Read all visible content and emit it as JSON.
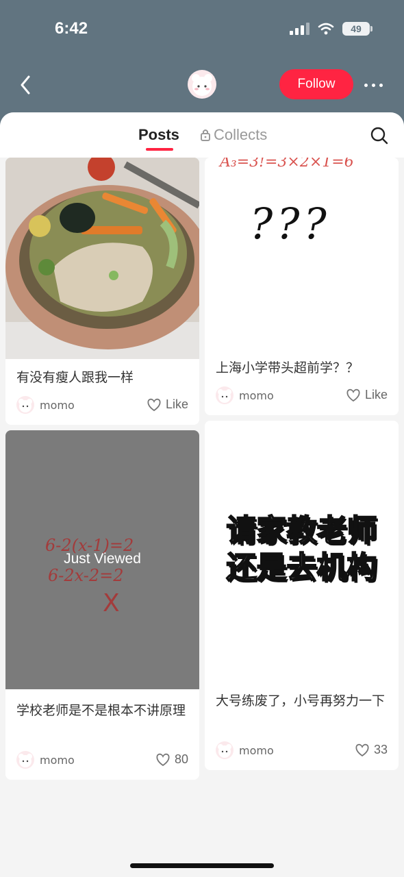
{
  "status": {
    "time": "6:42",
    "battery": "49"
  },
  "nav": {
    "follow_label": "Follow"
  },
  "tabs": {
    "posts": "Posts",
    "collects": "Collects"
  },
  "posts": [
    {
      "title": "有没有瘦人跟我一样",
      "author": "momo",
      "likes": "Like",
      "image": "food-bowl-photo"
    },
    {
      "title": "上海小学带头超前学？？",
      "author": "momo",
      "likes": "Like",
      "image_text_top": "A₃=3!=3×2×1=6",
      "image_text_main": "???"
    },
    {
      "title": "学校老师是不是根本不讲原理",
      "author": "momo",
      "likes": "80",
      "badge": "Just Viewed",
      "image_line1": "6-2(x-1)=2",
      "image_line2": "6-2x-2=2"
    },
    {
      "title": "大号练废了，小号再努力一下",
      "author": "momo",
      "likes": "33",
      "image_line1": "请家教老师",
      "image_line2": "还是去机构"
    }
  ],
  "colors": {
    "header": "#617480",
    "accent": "#ff2442",
    "background": "#f4f4f4"
  }
}
